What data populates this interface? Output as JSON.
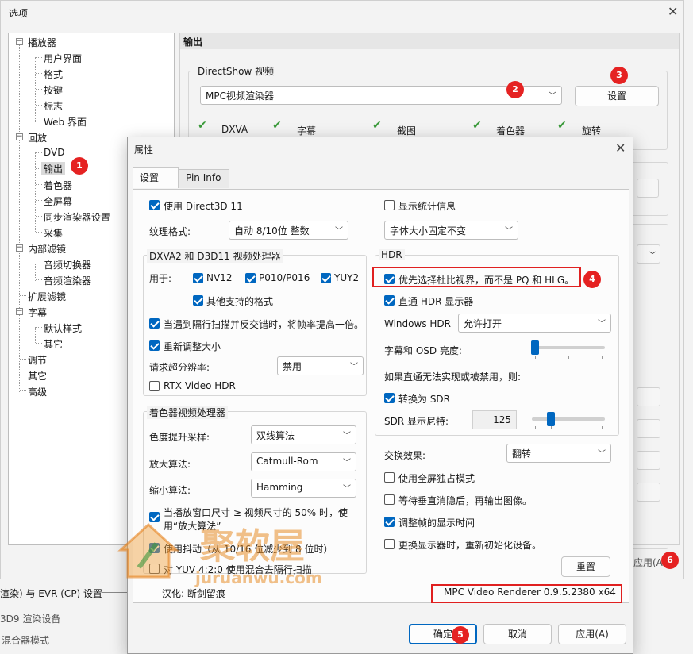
{
  "main_window": {
    "title": "选项",
    "tree": {
      "player": "播放器",
      "ui": "用户界面",
      "formats": "格式",
      "keys": "按键",
      "logo": "标志",
      "web": "Web 界面",
      "playback": "回放",
      "dvd": "DVD",
      "output": "输出",
      "shaders": "着色器",
      "fullscreen": "全屏幕",
      "sync": "同步渲染器设置",
      "capture": "采集",
      "internal_filters": "内部滤镜",
      "audio_switcher": "音频切换器",
      "audio_renderer": "音频渲染器",
      "external_filters": "扩展滤镜",
      "subtitles": "字幕",
      "default_style": "默认样式",
      "misc": "其它",
      "tweaks": "调节",
      "misc2": "其它",
      "advanced": "高级"
    },
    "output_header": "输出",
    "ds_group_label": "DirectShow 视频",
    "ds_combo": "MPC视频渲染器",
    "settings_button": "设置",
    "features": [
      "DXVA",
      "字幕",
      "截图",
      "着色器",
      "旋转"
    ],
    "apply_partial": "应用(A)",
    "evr_partial": "渲染) 与 EVR (CP) 设置",
    "d3d9_partial": "3D9 渲染设备",
    "mixer_partial": "混合器模式"
  },
  "dialog": {
    "title": "属性",
    "tabs": [
      "设置",
      "Pin Info"
    ],
    "use_d3d11": "使用 Direct3D 11",
    "show_stats": "显示统计信息",
    "texture_label": "纹理格式:",
    "texture_value": "自动 8/10位 整数",
    "font_value": "字体大小固定不变",
    "dxva_group": "DXVA2 和 D3D11 视频处理器",
    "use_for": "用于:",
    "nv12": "NV12",
    "p010": "P010/P016",
    "yuy2": "YUY2",
    "other_formats": "其他支持的格式",
    "double_rate": "当遇到隔行扫描并反交错时，将帧率提高一倍。",
    "resize": "重新调整大小",
    "superres_label": "请求超分辨率:",
    "superres_value": "禁用",
    "rtx_hdr": "RTX Video HDR",
    "shader_group": "着色器视频处理器",
    "chroma_label": "色度提升采样:",
    "chroma_value": "双线算法",
    "upscale_label": "放大算法:",
    "upscale_value": "Catmull-Rom",
    "downscale_label": "缩小算法:",
    "downscale_value": "Hamming",
    "half_size_1": "当播放窗口尺寸 ≥ 视频尺寸的 50% 时，使",
    "half_size_2": "用“放大算法”",
    "dither": "使用抖动（从 10/16 位减少到 8 位时）",
    "yuv420": "对 YUV 4:2:0 使用混合去隔行扫描",
    "credits": "汉化: 断剑留痕",
    "hdr_group": "HDR",
    "prefer_pq": "优先选择杜比视界，而不是 PQ 和 HLG。",
    "passthrough": "直通 HDR 显示器",
    "win_hdr_label": "Windows HDR",
    "win_hdr_value": "允许打开",
    "osd_brightness": "字幕和 OSD 亮度:",
    "fallback_note": "如果直通无法实现或被禁用，则:",
    "convert_sdr": "转换为 SDR",
    "sdr_nits_label": "SDR 显示尼特:",
    "sdr_nits_value": "125",
    "swap_label": "交换效果:",
    "swap_value": "翻转",
    "exclusive_fs": "使用全屏独占模式",
    "wait_vblank": "等待垂直消隐后，再输出图像。",
    "adjust_frame": "调整帧的显示时间",
    "reinit": "更换显示器时，重新初始化设备。",
    "reset_button": "重置",
    "version": "MPC Video Renderer 0.9.5.2380 x64",
    "ok": "确定",
    "cancel": "取消",
    "apply": "应用(A)"
  },
  "badges": [
    "1",
    "2",
    "3",
    "4",
    "5",
    "6"
  ],
  "watermark": {
    "cn": "聚软屋",
    "url": "juruanwu.com"
  },
  "colors": {
    "accent": "#0067c0",
    "highlight": "#e02020",
    "check_green": "#3a9a3a"
  }
}
